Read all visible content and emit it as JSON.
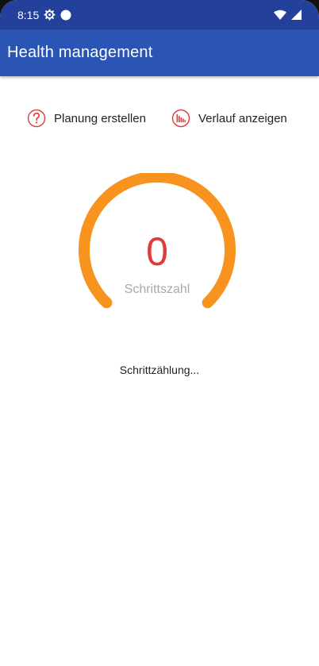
{
  "status_bar": {
    "time": "8:15",
    "icons": [
      "settings-gear-icon",
      "circle-dot-icon",
      "wifi-icon",
      "cell-signal-icon"
    ]
  },
  "app_bar": {
    "title": "Health management",
    "color": "#2b55b5"
  },
  "actions": {
    "plan_label": "Planung erstellen",
    "plan_icon": "question-circle-icon",
    "history_label": "Verlauf anzeigen",
    "history_icon": "bar-chart-circle-icon",
    "icon_color": "#e03a3a"
  },
  "gauge": {
    "value": "0",
    "label": "Schrittszahl",
    "arc_color": "#f7931e",
    "value_color": "#e03a3a"
  },
  "status_text": "Schrittzählung..."
}
